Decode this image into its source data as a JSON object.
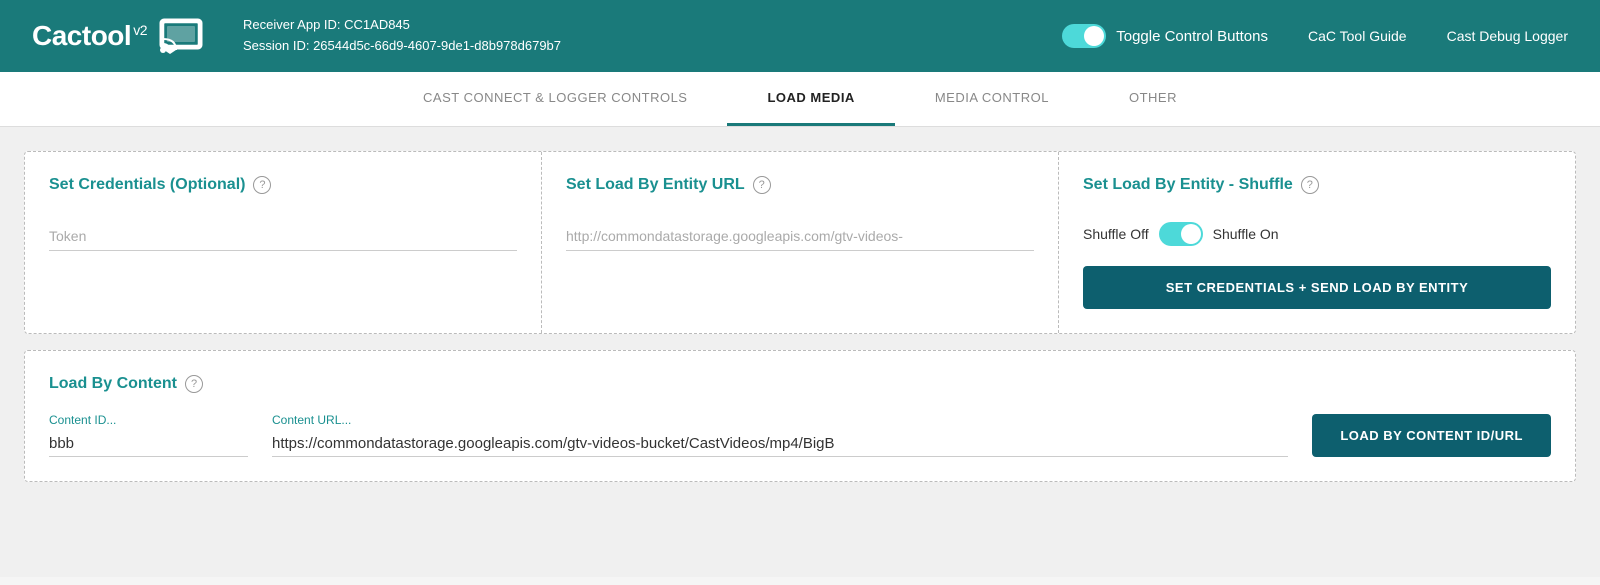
{
  "header": {
    "logo_text": "Cactool",
    "logo_version": "v2",
    "receiver_app_id_label": "Receiver App ID: CC1AD845",
    "session_id_label": "Session ID: 26544d5c-66d9-4607-9de1-d8b978d679b7",
    "toggle_label": "Toggle Control Buttons",
    "nav_links": [
      {
        "label": "CaC Tool Guide"
      },
      {
        "label": "Cast Debug Logger"
      }
    ]
  },
  "tabs": [
    {
      "label": "CAST CONNECT & LOGGER CONTROLS",
      "active": false
    },
    {
      "label": "LOAD MEDIA",
      "active": true
    },
    {
      "label": "MEDIA CONTROL",
      "active": false
    },
    {
      "label": "OTHER",
      "active": false
    }
  ],
  "load_media": {
    "set_credentials": {
      "title": "Set Credentials (Optional)",
      "token_placeholder": "Token"
    },
    "set_load_by_entity_url": {
      "title": "Set Load By Entity URL",
      "url_placeholder": "http://commondatastorage.googleapis.com/gtv-videos-"
    },
    "set_load_by_entity_shuffle": {
      "title": "Set Load By Entity - Shuffle",
      "shuffle_off_label": "Shuffle Off",
      "shuffle_on_label": "Shuffle On",
      "button_label": "SET CREDENTIALS + SEND LOAD BY ENTITY"
    },
    "load_by_content": {
      "title": "Load By Content",
      "content_id_label": "Content ID...",
      "content_id_value": "bbb",
      "content_url_label": "Content URL...",
      "content_url_value": "https://commondatastorage.googleapis.com/gtv-videos-bucket/CastVideos/mp4/BigB",
      "button_label": "LOAD BY CONTENT ID/URL"
    }
  },
  "colors": {
    "teal_dark": "#1a7a7a",
    "teal_accent": "#1a9090",
    "teal_button": "#0d5f6e",
    "toggle_bg": "#4dd9d9"
  }
}
